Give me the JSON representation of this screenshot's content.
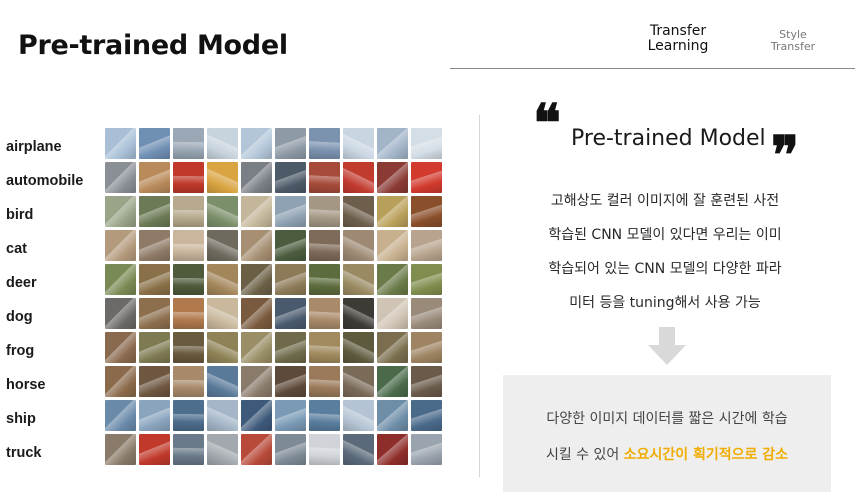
{
  "header": {
    "title": "Pre-trained Model",
    "tabs": [
      {
        "line1": "Transfer",
        "line2": "Learning",
        "active": true
      },
      {
        "line1": "Style",
        "line2": "Transfer",
        "active": false
      }
    ]
  },
  "figure": {
    "classes": [
      "airplane",
      "automobile",
      "bird",
      "cat",
      "deer",
      "dog",
      "frog",
      "horse",
      "ship",
      "truck"
    ],
    "thumbnail_palettes": [
      [
        "#a8bfd6",
        "#6f8fb4",
        "#9aa8b6",
        "#c7d3dd",
        "#b3c6d9",
        "#8e9aa6",
        "#7c93b0",
        "#c9d6e2",
        "#a2b4c8",
        "#d4dee6"
      ],
      [
        "#8a8f96",
        "#b98a5a",
        "#c0392b",
        "#d9a441",
        "#7a7f86",
        "#4d5a68",
        "#a64b3a",
        "#c23b2f",
        "#8b3a34",
        "#d23a2e"
      ],
      [
        "#9aa488",
        "#6c7a55",
        "#b6a98c",
        "#7b8f6a",
        "#c4b69a",
        "#8fa2b3",
        "#a49884",
        "#6e5e4c",
        "#b9a05a",
        "#8a4f2b"
      ],
      [
        "#b49a7c",
        "#8e7a66",
        "#c9b69c",
        "#6f6a5e",
        "#a68f72",
        "#4b5d3e",
        "#7e6a58",
        "#9e8a74",
        "#c7b08e",
        "#b8a48e"
      ],
      [
        "#7a8a54",
        "#8a7048",
        "#4f5b3a",
        "#a3865a",
        "#6b6046",
        "#8c7a58",
        "#5d6c3e",
        "#9a8a62",
        "#6a7a48",
        "#7f8e4e"
      ],
      [
        "#6b6a68",
        "#8d6f4e",
        "#b17a4d",
        "#c9b89c",
        "#7a5a3e",
        "#4a5a6e",
        "#a98a6a",
        "#3e3a36",
        "#d0c4b4",
        "#9a8a7a"
      ],
      [
        "#8a6a4e",
        "#7e7a52",
        "#6a5a3e",
        "#8e8256",
        "#9a8e66",
        "#6e6a4a",
        "#a08a5e",
        "#5e5a3e",
        "#7a6e4e",
        "#9e8462"
      ],
      [
        "#8a6a4a",
        "#6e5640",
        "#a88a6a",
        "#5a7a9a",
        "#8a7a6a",
        "#5e4a3a",
        "#9a7a5a",
        "#7a6a58",
        "#4a6a4a",
        "#6a5a4a"
      ],
      [
        "#6a8aaa",
        "#8aa4be",
        "#4e6e8e",
        "#a4b6c8",
        "#3e5a7a",
        "#7a9ab6",
        "#5a7e9e",
        "#b4c4d4",
        "#6e8ea8",
        "#4a6a8a"
      ],
      [
        "#8a7a6a",
        "#c0392b",
        "#6a7a8a",
        "#a2a8ae",
        "#b84a3a",
        "#7e8a96",
        "#d0d4d8",
        "#5a6a7a",
        "#8e2e2a",
        "#9aa4ae"
      ]
    ]
  },
  "quote": {
    "open_mark": "❝",
    "close_mark": "❞",
    "title": "Pre-trained Model"
  },
  "body_lines": [
    "고해상도 컬러 이미지에 잘 훈련된 사전",
    "학습된 CNN 모델이 있다면 우리는 이미",
    "학습되어 있는 CNN 모델의 다양한 파라",
    "미터 등을 tuning해서 사용 가능"
  ],
  "arrow": {
    "icon": "arrow-down-icon",
    "color": "#d9d9d9"
  },
  "result": {
    "line1": "다양한 이미지 데이터를 짧은 시간에 학습",
    "line2_prefix": "시킬 수 있어 ",
    "line2_highlight": "소요시간이 획기적으로 감소",
    "highlight_color": "#f0ac00",
    "background_color": "#eeeeee"
  }
}
